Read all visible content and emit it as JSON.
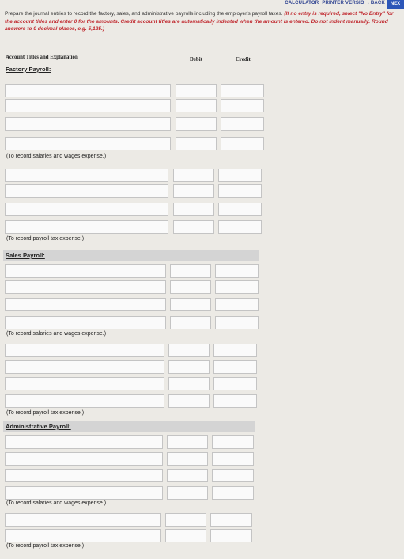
{
  "nav": {
    "calculator": "CALCULATOR",
    "printer": "PRINTER VERSIO",
    "back": "‹ BACK",
    "next": "NEX"
  },
  "instructions": {
    "plain": "Prepare the journal entries to record the factory, sales, and administrative payrolls including the employer's payroll taxes.",
    "red": "(If no entry is required, select \"No Entry\" for the account titles and enter 0 for the amounts. Credit account titles are automatically indented when the amount is entered. Do not indent manually. Round answers to 0 decimal places, e.g. 5,125.)"
  },
  "table": {
    "col_account": "Account Titles and Explanation",
    "col_debit": "Debit",
    "col_credit": "Credit"
  },
  "sections": [
    {
      "title": "Factory Payroll:",
      "note1": "(To record salaries and wages expense.)",
      "note2": "(To record payroll tax expense.)"
    },
    {
      "title": "Sales Payroll:",
      "note1": "(To record salaries and wages expense.)",
      "note2": "(To record payroll tax expense.)"
    },
    {
      "title": "Administrative Payroll:",
      "note1": "(To record salaries and wages expense.)",
      "note2": "(To record payroll tax expense.)"
    }
  ]
}
